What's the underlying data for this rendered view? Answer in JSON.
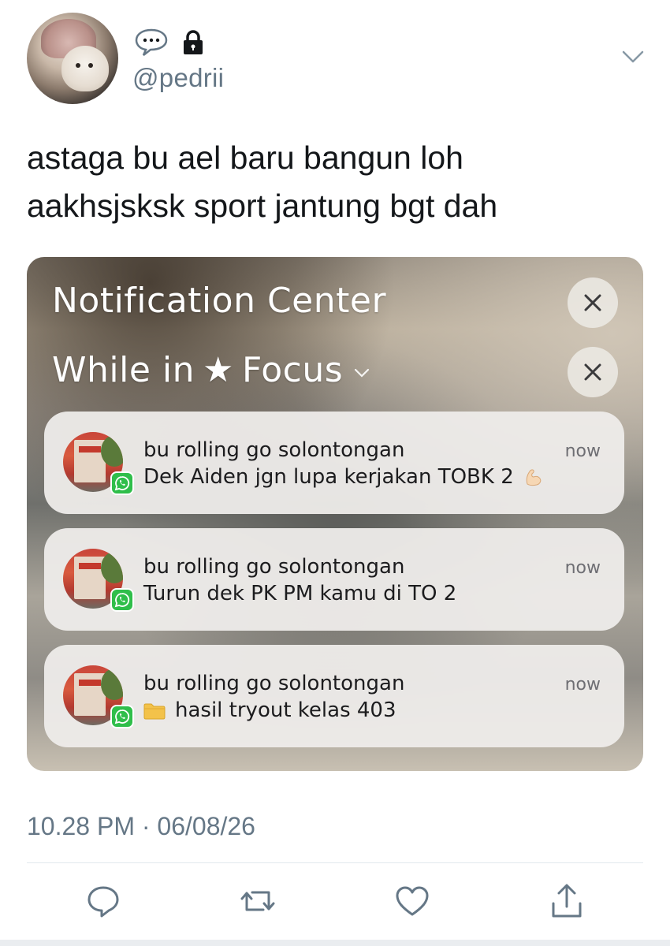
{
  "tweet": {
    "handle": "@pedrii",
    "text_line1": "astaga bu ael baru bangun loh",
    "text_line2": "aakhsjsksk sport jantung bgt dah",
    "timestamp": "10.28 PM · 06/08/26"
  },
  "screenshot": {
    "title": "Notification Center",
    "focus_prefix": "While in",
    "focus_star": "★",
    "focus_label": "Focus",
    "notifications": [
      {
        "sender": "bu rolling go solontongan",
        "body": "Dek Aiden jgn lupa kerjakan TOBK 2",
        "time": "now",
        "app_icon": "whatsapp-icon",
        "emoji": "flexed-biceps-icon"
      },
      {
        "sender": "bu rolling go solontongan",
        "body": "Turun dek PK PM kamu di TO 2",
        "time": "now",
        "app_icon": "whatsapp-icon"
      },
      {
        "sender": "bu rolling go solontongan",
        "body": "hasil tryout kelas 403",
        "time": "now",
        "app_icon": "whatsapp-icon",
        "emoji": "folder-icon"
      }
    ]
  },
  "colors": {
    "text": "#14171a",
    "secondary": "#657786",
    "whatsapp": "#2fbe4a"
  },
  "icons": [
    "speech-bubble-icon",
    "lock-icon",
    "chevron-down-icon",
    "close-icon",
    "reply-icon",
    "retweet-icon",
    "like-icon",
    "share-icon"
  ]
}
